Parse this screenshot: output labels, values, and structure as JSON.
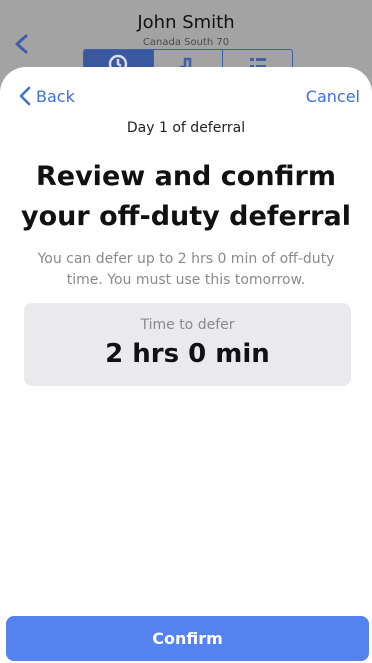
{
  "background": {
    "driver_name": "John Smith",
    "ruleset": "Canada South 70",
    "tabs": [
      {
        "icon": "clock-icon"
      },
      {
        "icon": "graph-icon"
      },
      {
        "icon": "list-icon"
      }
    ]
  },
  "sheet": {
    "back_label": "Back",
    "cancel_label": "Cancel",
    "day_label": "Day 1 of deferral",
    "title": "Review and confirm your off-duty deferral",
    "description": "You can defer up to 2 hrs 0 min of off-duty time. You must use this tomorrow.",
    "defer_label": "Time to defer",
    "defer_value": "2 hrs 0 min",
    "confirm_label": "Confirm"
  },
  "colors": {
    "accent": "#3f6fd8",
    "button": "#5483f0",
    "card": "#e9e9ee"
  }
}
